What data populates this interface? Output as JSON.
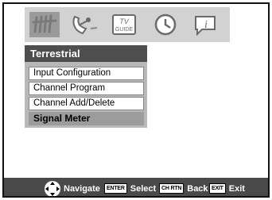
{
  "tabs": [
    {
      "icon": "antenna-icon"
    },
    {
      "icon": "satellite-dish-icon"
    },
    {
      "icon": "tv-guide-icon",
      "text_line1": "TV",
      "text_line2": "GUIDE"
    },
    {
      "icon": "clock-icon"
    },
    {
      "icon": "info-icon",
      "text": "i"
    }
  ],
  "menu": {
    "title": "Terrestrial",
    "items": [
      {
        "label": "Input Configuration"
      },
      {
        "label": "Channel Program"
      },
      {
        "label": "Channel Add/Delete"
      },
      {
        "label": "Signal Meter"
      }
    ],
    "selected_index": 3
  },
  "nav": {
    "navigate_label": "Navigate",
    "enter_key": "ENTER",
    "select_label": "Select",
    "chrtn_key": "CH RTN",
    "back_label": "Back",
    "exit_key": "EXIT",
    "exit_label": "Exit"
  },
  "colors": {
    "title_bar": "#4e4e4e",
    "selected_item": "#9c9c9c",
    "menu_background": "#b8b8b8",
    "nav_bar": "#4a4a4a"
  }
}
